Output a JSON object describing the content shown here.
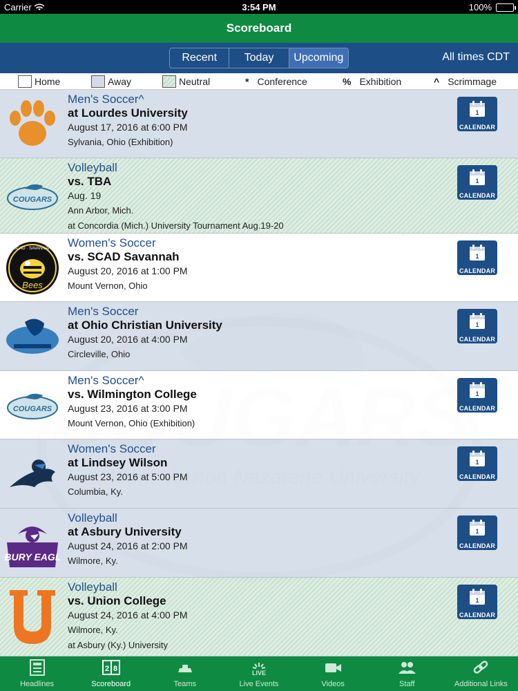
{
  "status_bar": {
    "carrier": "Carrier",
    "time": "3:54 PM",
    "battery": "100%"
  },
  "header": {
    "title": "Scoreboard"
  },
  "segments": {
    "items": [
      "Recent",
      "Today",
      "Upcoming"
    ],
    "selected": "Upcoming"
  },
  "timezone": "All times CDT",
  "legend": {
    "home": "Home",
    "away": "Away",
    "neutral": "Neutral",
    "conference_symbol": "*",
    "conference": "Conference",
    "exhibition_symbol": "%",
    "exhibition": "Exhibition",
    "scrimmage_symbol": "^",
    "scrimmage": "Scrimmage"
  },
  "calendar_label": "CALENDAR",
  "calendar_day": "1",
  "colors": {
    "green": "#0f8a43",
    "navy": "#1d4e86",
    "away_row": "#d2dbe7",
    "link_blue": "#1f4f8d"
  },
  "events": [
    {
      "sport": "Men's Soccer^",
      "opponent": "at Lourdes University",
      "date": "August 17, 2016 at 6:00 PM",
      "location": "Sylvania, Ohio (Exhibition)",
      "extra": "",
      "type": "away",
      "logo": "paw-logo"
    },
    {
      "sport": "Volleyball",
      "opponent": "vs. TBA",
      "date": "Aug. 19",
      "location": "Ann Arbor, Mich.",
      "extra": "at Concordia (Mich.) University Tournament Aug.19-20",
      "type": "neutral",
      "logo": "cougars-logo",
      "logo_text": "COUGARS"
    },
    {
      "sport": "Women's Soccer",
      "opponent": "vs. SCAD Savannah",
      "date": "August 20, 2016 at 1:00 PM",
      "location": "Mount Vernon, Ohio",
      "extra": "",
      "type": "home",
      "logo": "scad-bee-logo",
      "logo_text": "SCAD · SAVANNAH"
    },
    {
      "sport": "Men's Soccer",
      "opponent": "at Ohio Christian University",
      "date": "August 20, 2016 at 4:00 PM",
      "location": "Circleville, Ohio",
      "extra": "",
      "type": "away",
      "logo": "trailblazers-logo"
    },
    {
      "sport": "Men's Soccer^",
      "opponent": "vs. Wilmington College",
      "date": "August 23, 2016 at 3:00 PM",
      "location": "Mount Vernon, Ohio (Exhibition)",
      "extra": "",
      "type": "home",
      "logo": "cougars-logo",
      "logo_text": "COUGARS"
    },
    {
      "sport": "Women's Soccer",
      "opponent": "at Lindsey Wilson",
      "date": "August 23, 2016 at 5:00 PM",
      "location": "Columbia, Ky.",
      "extra": "",
      "type": "away",
      "logo": "blue-raider-logo"
    },
    {
      "sport": "Volleyball",
      "opponent": "at Asbury University",
      "date": "August 24, 2016 at 2:00 PM",
      "location": "Wilmore, Ky.",
      "extra": "",
      "type": "away",
      "logo": "asbury-eagles-logo",
      "logo_text": "ASBURY EAGLES"
    },
    {
      "sport": "Volleyball",
      "opponent": "vs. Union College",
      "date": "August 24, 2016 at 4:00 PM",
      "location": "Wilmore, Ky.",
      "extra": "at Asbury (Ky.) University",
      "type": "neutral",
      "logo": "union-u-logo"
    }
  ],
  "watermark": {
    "wordmark": "COUGARS",
    "subtitle": "Mount Vernon Nazarene University"
  },
  "tabs": [
    {
      "label": "Headlines",
      "icon": "newspaper-icon"
    },
    {
      "label": "Scoreboard",
      "icon": "scoreboard-icon",
      "active": true
    },
    {
      "label": "Teams",
      "icon": "teams-icon"
    },
    {
      "label": "Live Events",
      "icon": "live-icon",
      "badge": "LIVE"
    },
    {
      "label": "Videos",
      "icon": "video-icon"
    },
    {
      "label": "Staff",
      "icon": "staff-icon"
    },
    {
      "label": "Additional Links",
      "icon": "link-icon"
    }
  ]
}
